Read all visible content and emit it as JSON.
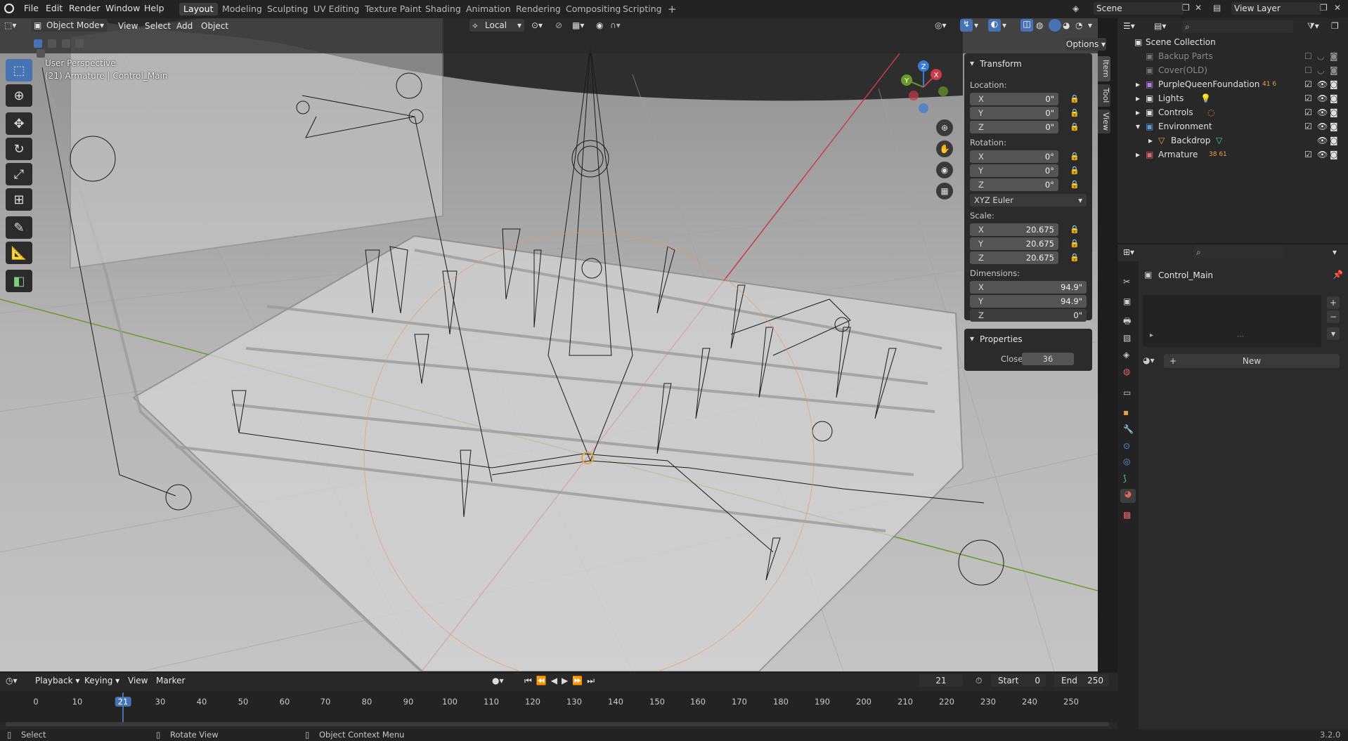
{
  "topbar": {
    "menus": [
      "File",
      "Edit",
      "Render",
      "Window",
      "Help"
    ],
    "workspaces": [
      "Layout",
      "Modeling",
      "Sculpting",
      "UV Editing",
      "Texture Paint",
      "Shading",
      "Animation",
      "Rendering",
      "Compositing",
      "Scripting"
    ],
    "active_workspace": "Layout",
    "add_tab": "+",
    "scene": "Scene",
    "view_layer": "View Layer"
  },
  "viewport_header": {
    "mode": "Object Mode",
    "menus": [
      "View",
      "Select",
      "Add",
      "Object"
    ],
    "orientation": "Local",
    "options": "Options"
  },
  "viewport": {
    "perspective": "User Perspective",
    "object_info": "(21) Armature | Control_Main"
  },
  "gizmo": {
    "x": "X",
    "y": "Y",
    "z": "Z"
  },
  "npanel": {
    "transform_title": "Transform",
    "location_label": "Location:",
    "location": [
      {
        "axis": "X",
        "value": "0\""
      },
      {
        "axis": "Y",
        "value": "0\""
      },
      {
        "axis": "Z",
        "value": "0\""
      }
    ],
    "rotation_label": "Rotation:",
    "rotation": [
      {
        "axis": "X",
        "value": "0°"
      },
      {
        "axis": "Y",
        "value": "0°"
      },
      {
        "axis": "Z",
        "value": "0°"
      }
    ],
    "rotation_mode": "XYZ Euler",
    "scale_label": "Scale:",
    "scale": [
      {
        "axis": "X",
        "value": "20.675"
      },
      {
        "axis": "Y",
        "value": "20.675"
      },
      {
        "axis": "Z",
        "value": "20.675"
      }
    ],
    "dimensions_label": "Dimensions:",
    "dimensions": [
      {
        "axis": "X",
        "value": "94.9\""
      },
      {
        "axis": "Y",
        "value": "94.9\""
      },
      {
        "axis": "Z",
        "value": "0\""
      }
    ],
    "properties_title": "Properties",
    "close_label": "Close",
    "close_value": "36",
    "tabs": [
      "Item",
      "Tool",
      "View"
    ]
  },
  "outliner": {
    "root": "Scene Collection",
    "rows": [
      {
        "name": "Backup Parts",
        "dim": true,
        "badge": ""
      },
      {
        "name": "Cover(OLD)",
        "dim": true,
        "badge": ""
      },
      {
        "name": "PurpleQueenFoundation",
        "dim": false,
        "badge": "41 6"
      },
      {
        "name": "Lights",
        "dim": false,
        "badge": ""
      },
      {
        "name": "Controls",
        "dim": false,
        "badge": ""
      },
      {
        "name": "Environment",
        "dim": false,
        "badge": ""
      },
      {
        "name": "Backdrop",
        "dim": false,
        "badge": ""
      },
      {
        "name": "Armature",
        "dim": false,
        "badge": "38 61"
      }
    ]
  },
  "properties": {
    "object_name": "Control_Main",
    "new_button": "New"
  },
  "timeline": {
    "menus": [
      "Playback",
      "Keying",
      "View",
      "Marker"
    ],
    "current_frame": "21",
    "start_label": "Start",
    "start": "0",
    "end_label": "End",
    "end": "250",
    "ticks": [
      "0",
      "10",
      "21",
      "30",
      "40",
      "50",
      "60",
      "70",
      "80",
      "90",
      "100",
      "110",
      "120",
      "130",
      "140",
      "150",
      "160",
      "170",
      "180",
      "190",
      "200",
      "210",
      "220",
      "230",
      "240",
      "250"
    ]
  },
  "statusbar": {
    "select": "Select",
    "rotate": "Rotate View",
    "context": "Object Context Menu",
    "version": "3.2.0"
  },
  "colors": {
    "accent": "#4772b3",
    "x_axis": "#c93a4a",
    "y_axis": "#6a9a2c",
    "z_axis": "#3a7ad6"
  }
}
